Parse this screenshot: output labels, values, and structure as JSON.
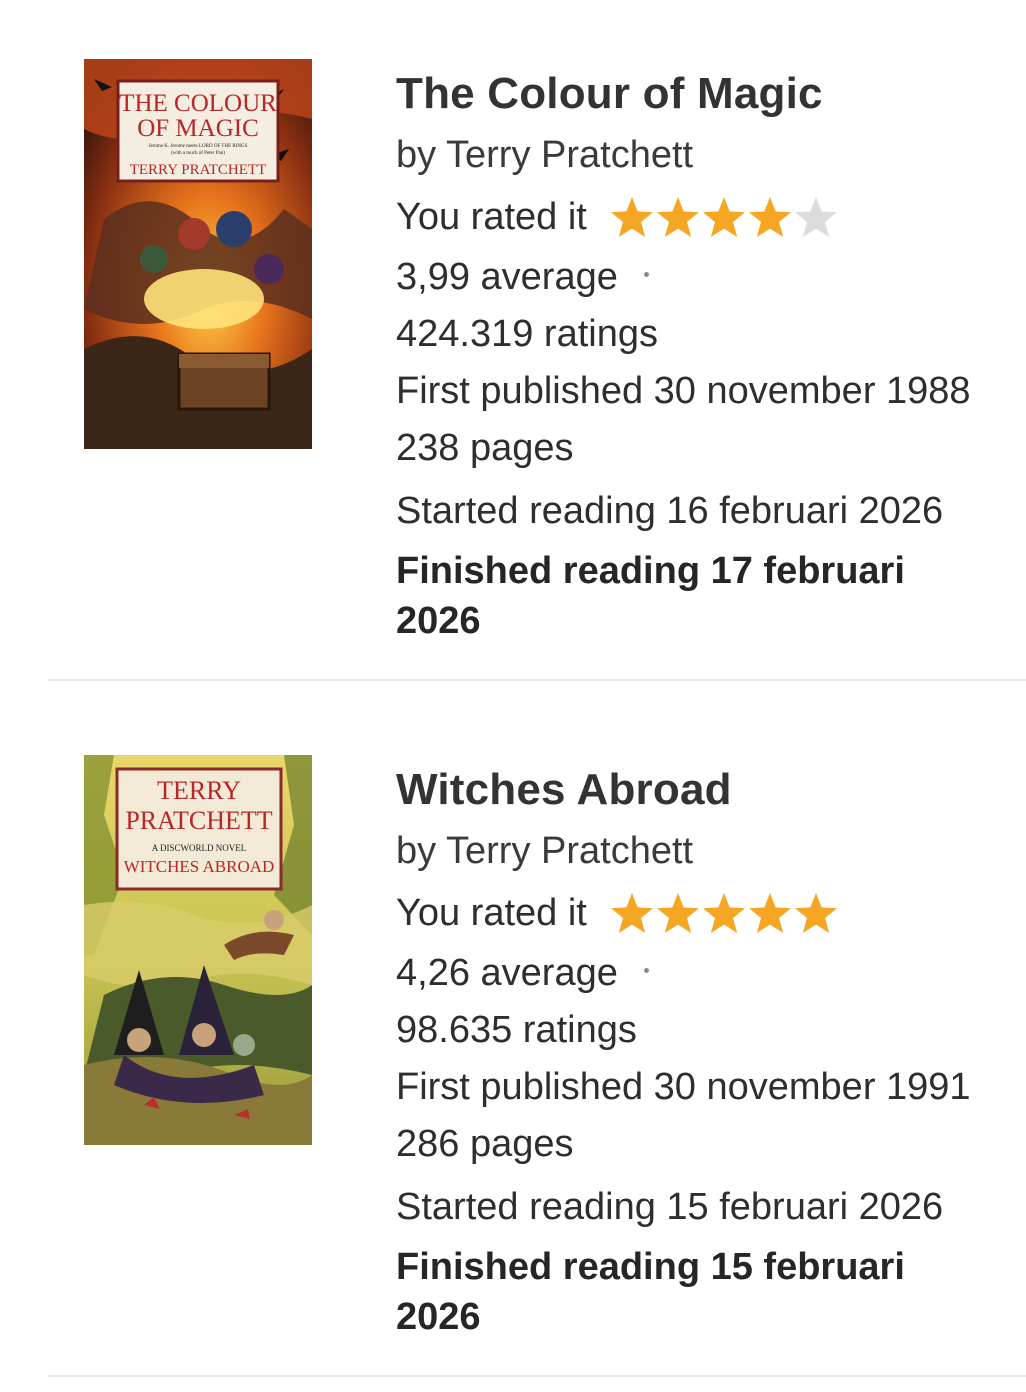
{
  "books": [
    {
      "title": "The Colour of Magic",
      "author": "by Terry Pratchett",
      "rated_label": "You rated it",
      "user_rating": 4,
      "max_rating": 5,
      "average": "3,99 average",
      "ratings": "424.319 ratings",
      "first_published": "First published 30 november 1988",
      "pages": "238 pages",
      "started": "Started reading 16 februari 2026",
      "finished": "Finished reading 17 februari 2026",
      "cover": {
        "line1": "THE COLOUR",
        "line2": "OF MAGIC",
        "tagline1": "Jerome K. Jerome meets LORD OF THE RINGS",
        "tagline2": "(with a touch of Peter Pan)",
        "author": "TERRY PRATCHETT"
      }
    },
    {
      "title": "Witches Abroad",
      "author": "by Terry Pratchett",
      "rated_label": "You rated it",
      "user_rating": 5,
      "max_rating": 5,
      "average": "4,26 average",
      "ratings": "98.635 ratings",
      "first_published": "First published 30 november 1991",
      "pages": "286 pages",
      "started": "Started reading 15 februari 2026",
      "finished": "Finished reading 15 februari 2026",
      "cover": {
        "line1": "TERRY",
        "line2": "PRATCHETT",
        "tagline1": "A DISCWORLD NOVEL",
        "tagline2": "WITCHES ABROAD",
        "author": ""
      }
    }
  ],
  "colors": {
    "star_filled": "#f5a623",
    "star_empty": "#dcdcdc",
    "divider": "#e6e6e6"
  }
}
